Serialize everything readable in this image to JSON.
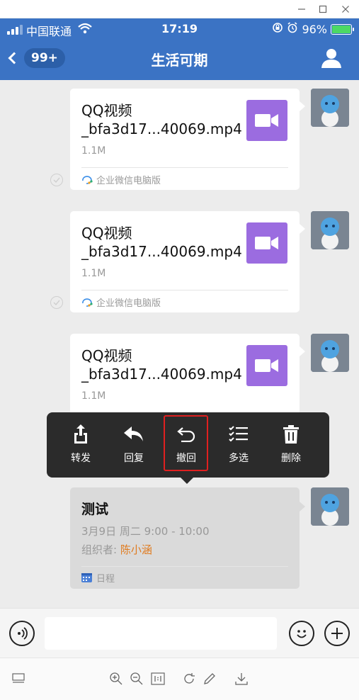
{
  "status_bar": {
    "carrier": "中国联通",
    "time": "17:19",
    "battery": "96%"
  },
  "nav": {
    "unread_badge": "99+",
    "title": "生活可期"
  },
  "messages": [
    {
      "file_name": "QQ视频_bfa3d17...40069.mp4",
      "file_size": "1.1M",
      "source": "企业微信电脑版"
    },
    {
      "file_name": "QQ视频_bfa3d17...40069.mp4",
      "file_size": "1.1M",
      "source": "企业微信电脑版"
    },
    {
      "file_name": "QQ视频_bfa3d17...40069.mp4",
      "file_size": "1.1M"
    }
  ],
  "calendar_event": {
    "title": "测试",
    "time": "3月9日 周二 9:00 - 10:00",
    "organizer_label": "组织者: ",
    "organizer_name": "陈小涵",
    "tag": "日程"
  },
  "context_menu": {
    "items": [
      {
        "label": "转发",
        "icon": "share-icon"
      },
      {
        "label": "回复",
        "icon": "reply-icon"
      },
      {
        "label": "撤回",
        "icon": "undo-icon",
        "highlighted": true
      },
      {
        "label": "多选",
        "icon": "checklist-icon"
      },
      {
        "label": "删除",
        "icon": "trash-icon"
      }
    ],
    "highlight_color": "#e02020"
  },
  "colors": {
    "nav_blue": "#3b73c4",
    "video_icon": "#9b6ce0",
    "organizer_orange": "#e07b1f"
  }
}
